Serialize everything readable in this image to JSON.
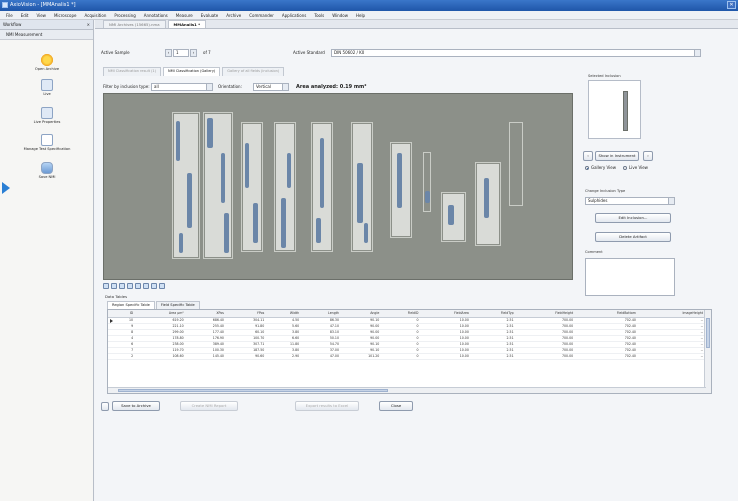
{
  "window": {
    "title": "AxioVision - [MMAnalis1 *]"
  },
  "menu": [
    "File",
    "Edit",
    "View",
    "Microscope",
    "Acquisition",
    "Processing",
    "Annotations",
    "Measure",
    "Evaluate",
    "Archive",
    "Commander",
    "Applications",
    "Tools",
    "Window",
    "Help"
  ],
  "left_panel": {
    "header": "Workflow",
    "subheader": "NMI Measurement",
    "items": [
      "Open Archive",
      "Live",
      "Live Properties",
      "Manage Test Specification",
      "Save NMI"
    ]
  },
  "doc_tabs": [
    {
      "label": "NMI Archives (15665).nma",
      "active": false
    },
    {
      "label": "MMAnalis1 *",
      "active": true
    }
  ],
  "sample": {
    "active_sample_label": "Active Sample",
    "sample_value": "1",
    "sample_of": "of 7",
    "active_standard_label": "Active Standard",
    "standard_value": "DIN 50602 / K0"
  },
  "sub_tabs": [
    {
      "label": "NMI Classification result (1)",
      "active": false
    },
    {
      "label": "NMI Classification (Gallery)",
      "active": true
    },
    {
      "label": "Gallery of all fields (inclusion)",
      "active": false
    }
  ],
  "filter": {
    "label": "Filter by inclusion type:",
    "value": "all",
    "orientation_label": "Orientation:",
    "orientation_value": "Vertical",
    "area_analyzed": "Area analyzed: 0.19 mm²"
  },
  "right_panel": {
    "selected_inclusion_label": "Selected Inclusion",
    "show_button": "Show in Instrument",
    "view_options": [
      "Gallery View",
      "Live View"
    ],
    "change_type_label": "Change Inclusion Type",
    "type_value": "Sulphides",
    "edit_button": "Edit Inclusion...",
    "delete_button": "Delete Artifact",
    "comment_label": "Comment"
  },
  "data_table": {
    "title": "Data Tables",
    "tabs": [
      {
        "label": "Region Specific Table",
        "active": true
      },
      {
        "label": "Field Specific Table",
        "active": false
      }
    ],
    "columns": [
      "ID",
      "Area µm²",
      "XPos",
      "YPos",
      "Width",
      "Length",
      "Angle",
      "FieldID",
      "FieldArea",
      "FieldTyp",
      "FieldHeight",
      "FieldBottom",
      "ImageHeight"
    ],
    "rows": [
      [
        "10",
        "619.20",
        "686.40",
        "304.11",
        "4.50",
        "86.30",
        "90.10",
        "0",
        "10.00",
        "2.51",
        "700.00",
        "702.40",
        "--"
      ],
      [
        "9",
        "221.10",
        "255.40",
        "91.80",
        "5.60",
        "47.10",
        "90.00",
        "0",
        "10.00",
        "2.51",
        "700.00",
        "702.40",
        "--"
      ],
      [
        "8",
        "299.00",
        "177.40",
        "60.10",
        "3.80",
        "83.10",
        "90.00",
        "0",
        "10.00",
        "2.51",
        "700.00",
        "702.40",
        "--"
      ],
      [
        "4",
        "178.80",
        "176.90",
        "100.70",
        "6.60",
        "50.10",
        "90.00",
        "0",
        "10.00",
        "2.51",
        "700.00",
        "702.40",
        "--"
      ],
      [
        "6",
        "238.00",
        "389.40",
        "307.71",
        "11.80",
        "54.70",
        "90.10",
        "0",
        "10.00",
        "2.51",
        "700.00",
        "702.40",
        "--"
      ],
      [
        "7",
        "119.70",
        "100.30",
        "187.50",
        "3.80",
        "37.00",
        "90.10",
        "0",
        "10.00",
        "2.51",
        "700.00",
        "702.40",
        "--"
      ],
      [
        "2",
        "108.60",
        "145.40",
        "90.60",
        "2.90",
        "47.00",
        "101.20",
        "0",
        "10.00",
        "2.51",
        "700.00",
        "702.40",
        "--"
      ]
    ]
  },
  "footer": {
    "save_archive": "Save to Archive",
    "create_report": "Create NMI Report",
    "export_excel": "Export results to Excel",
    "close": "Close"
  }
}
